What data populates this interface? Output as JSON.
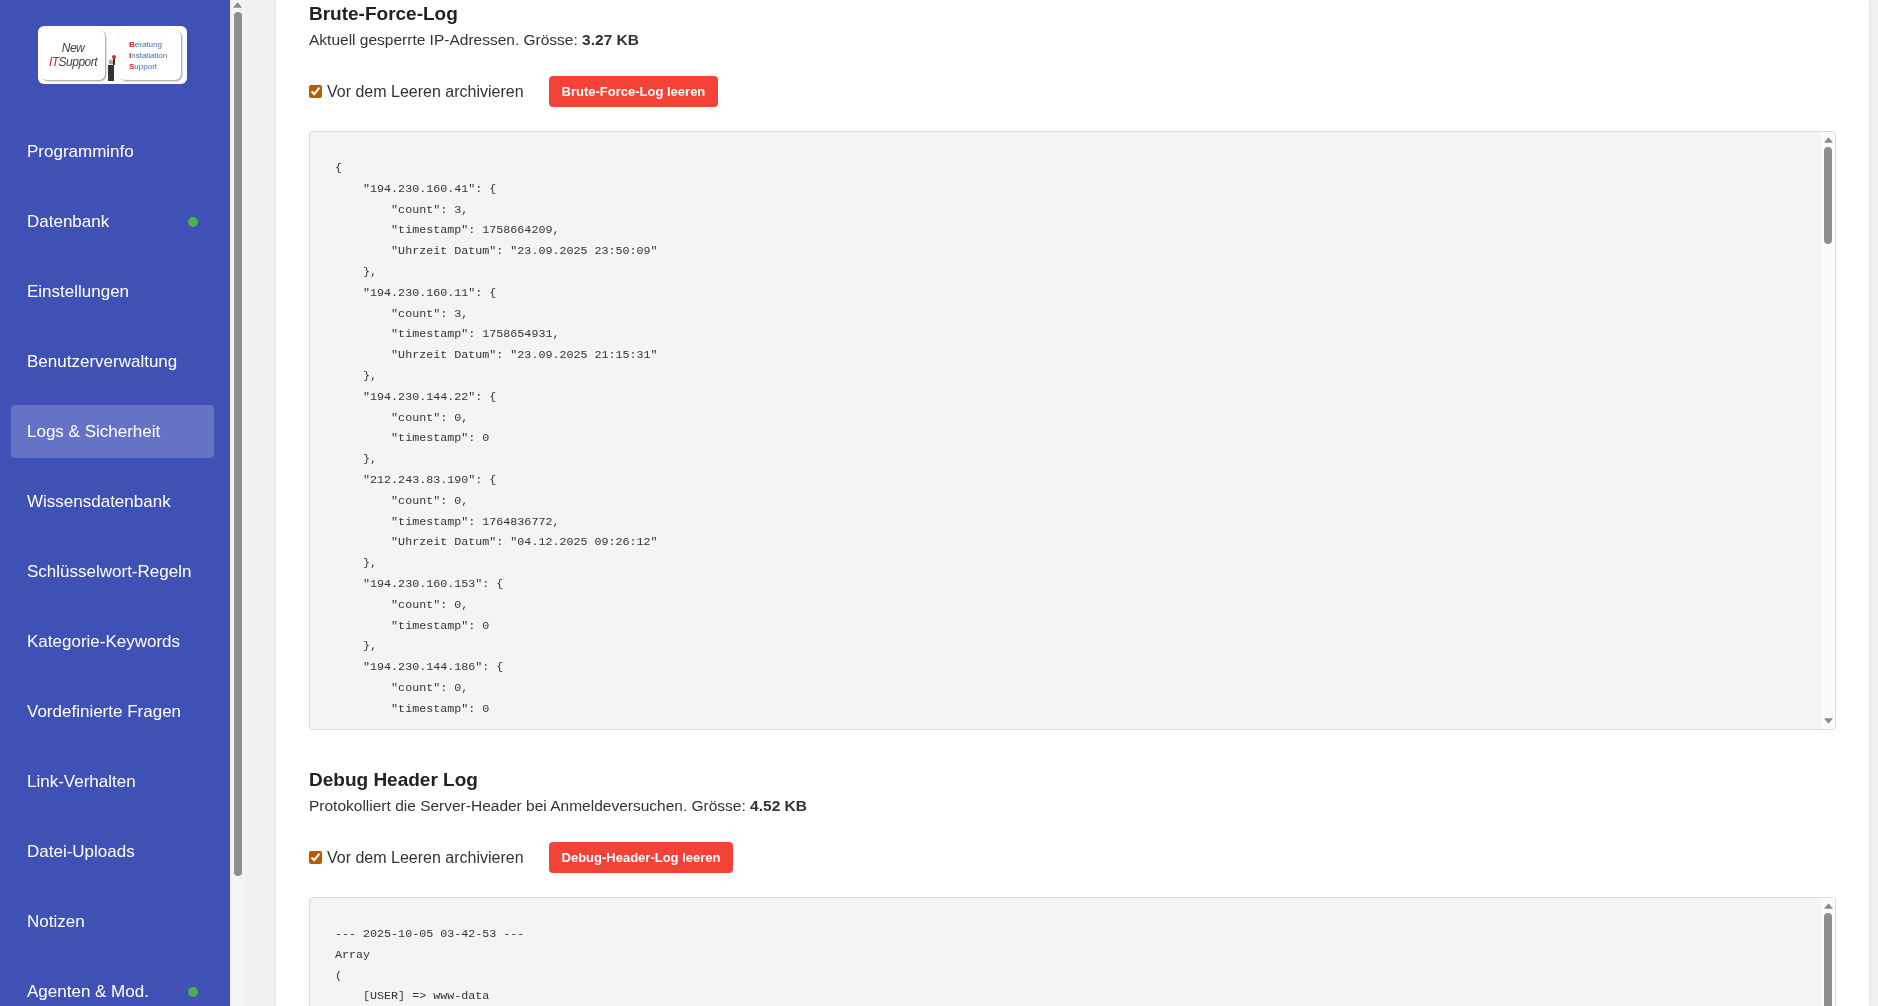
{
  "sidebar": {
    "logo": {
      "left_lines": [
        {
          "rest": "New"
        },
        {
          "accent": "IT",
          "rest": "Support"
        }
      ],
      "right_lines": [
        "Beratung",
        "Installation",
        "Support"
      ]
    },
    "items": [
      {
        "label": "Programminfo",
        "selected": false,
        "online": false
      },
      {
        "label": "Datenbank",
        "selected": false,
        "online": true
      },
      {
        "label": "Einstellungen",
        "selected": false,
        "online": false
      },
      {
        "label": "Benutzerverwaltung",
        "selected": false,
        "online": false
      },
      {
        "label": "Logs & Sicherheit",
        "selected": true,
        "online": false
      },
      {
        "label": "Wissensdatenbank",
        "selected": false,
        "online": false
      },
      {
        "label": "Schlüsselwort-Regeln",
        "selected": false,
        "online": false
      },
      {
        "label": "Kategorie-Keywords",
        "selected": false,
        "online": false
      },
      {
        "label": "Vordefinierte Fragen",
        "selected": false,
        "online": false
      },
      {
        "label": "Link-Verhalten",
        "selected": false,
        "online": false
      },
      {
        "label": "Datei-Uploads",
        "selected": false,
        "online": false
      },
      {
        "label": "Notizen",
        "selected": false,
        "online": false
      },
      {
        "label": "Agenten & Mod.",
        "selected": false,
        "online": true
      }
    ]
  },
  "sections": [
    {
      "title": "Brute-Force-Log",
      "description": "Aktuell gesperrte IP-Adressen. Grösse: **3.27 KB**",
      "archive": {
        "label": "Vor dem Leeren archivieren",
        "checked": true
      },
      "button": "Brute-Force-Log leeren",
      "code_lines": [
        "{",
        "    \"194.230.160.41\": {",
        "        \"count\": 3,",
        "        \"timestamp\": 1758664209,",
        "        \"Uhrzeit Datum\": \"23.09.2025 23:50:09\"",
        "    },",
        "    \"194.230.160.11\": {",
        "        \"count\": 3,",
        "        \"timestamp\": 1758654931,",
        "        \"Uhrzeit Datum\": \"23.09.2025 21:15:31\"",
        "    },",
        "    \"194.230.144.22\": {",
        "        \"count\": 0,",
        "        \"timestamp\": 0",
        "    },",
        "    \"212.243.83.190\": {",
        "        \"count\": 0,",
        "        \"timestamp\": 1764836772,",
        "        \"Uhrzeit Datum\": \"04.12.2025 09:26:12\"",
        "    },",
        "    \"194.230.160.153\": {",
        "        \"count\": 0,",
        "        \"timestamp\": 0",
        "    },",
        "    \"194.230.144.186\": {",
        "        \"count\": 0,",
        "        \"timestamp\": 0"
      ]
    },
    {
      "title": "Debug Header Log",
      "description": "Protokolliert die Server-Header bei Anmeldeversuchen. Grösse: **4.52 KB**",
      "archive": {
        "label": "Vor dem Leeren archivieren",
        "checked": true
      },
      "button": "Debug-Header-Log leeren",
      "code_lines": [
        "--- 2025-10-05 03-42-53 ---",
        "Array",
        "(",
        "    [USER] => www-data"
      ]
    }
  ]
}
